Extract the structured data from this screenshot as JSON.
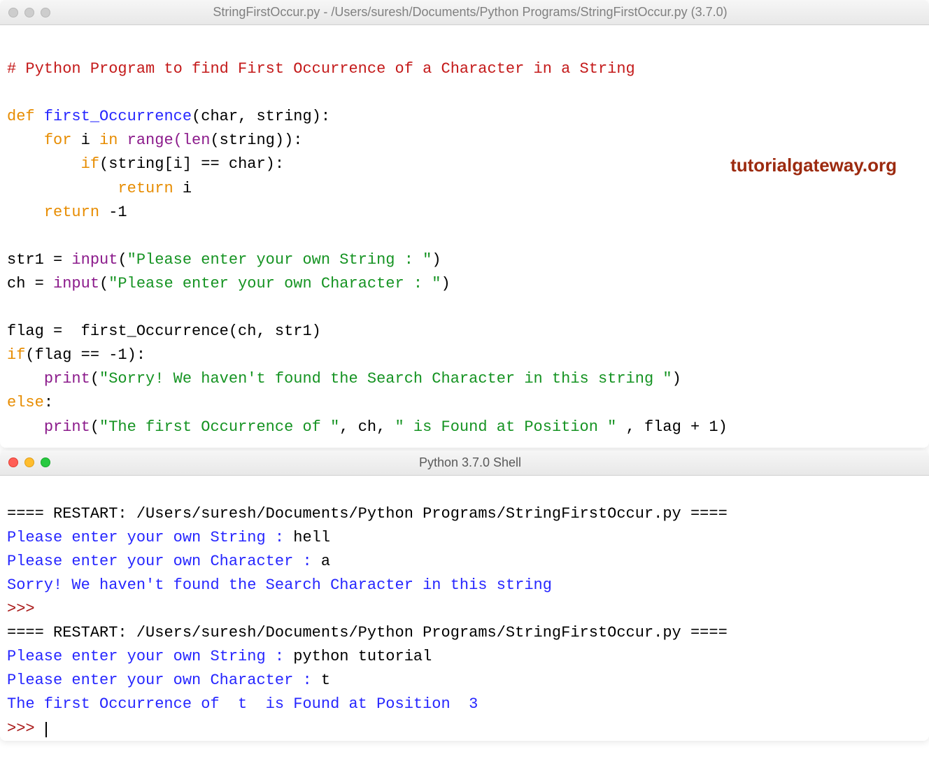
{
  "editor": {
    "title": "StringFirstOccur.py - /Users/suresh/Documents/Python Programs/StringFirstOccur.py (3.7.0)",
    "traffic_state": "inactive",
    "watermark": "tutorialgateway.org",
    "code": {
      "l1_comment": "# Python Program to find First Occurrence of a Character in a String",
      "l3_def": "def",
      "l3_func": " first_Occurrence",
      "l3_rest": "(char, string):",
      "l4_for": "for",
      "l4_i": " i ",
      "l4_in": "in",
      "l4_range": " range",
      "l4_len": "(len",
      "l4_end": "(string)):",
      "l5_if": "if",
      "l5_rest": "(string[i] == char):",
      "l6_return": "return",
      "l6_rest": " i",
      "l7_return": "return",
      "l7_rest": " -1",
      "l9_lhs": "str1 = ",
      "l9_input": "input",
      "l9_paren": "(",
      "l9_str": "\"Please enter your own String : \"",
      "l9_close": ")",
      "l10_lhs": "ch = ",
      "l10_input": "input",
      "l10_paren": "(",
      "l10_str": "\"Please enter your own Character : \"",
      "l10_close": ")",
      "l12": "flag =  first_Occurrence(ch, str1)",
      "l13_if": "if",
      "l13_rest": "(flag == -1):",
      "l14_print": "print",
      "l14_paren": "(",
      "l14_str": "\"Sorry! We haven't found the Search Character in this string \"",
      "l14_close": ")",
      "l15_else": "else",
      "l15_colon": ":",
      "l16_print": "print",
      "l16_paren": "(",
      "l16_str1": "\"The first Occurrence of \"",
      "l16_mid": ", ch, ",
      "l16_str2": "\" is Found at Position \"",
      "l16_end": " , flag + 1)"
    }
  },
  "shell": {
    "title": "Python 3.7.0 Shell",
    "traffic_state": "active",
    "lines": {
      "r1_pre": "==== ",
      "r1_restart": "RESTART: /Users/suresh/Documents/Python Programs/StringFirstOccur.py",
      "r1_post": " ====",
      "p1a": "Please enter your own String : ",
      "p1a_in": "hell",
      "p1b": "Please enter your own Character : ",
      "p1b_in": "a",
      "out1": "Sorry! We haven't found the Search Character in this string ",
      "prompt": ">>> ",
      "r2_pre": "==== ",
      "r2_restart": "RESTART: /Users/suresh/Documents/Python Programs/StringFirstOccur.py",
      "r2_post": " ====",
      "p2a": "Please enter your own String : ",
      "p2a_in": "python tutorial",
      "p2b": "Please enter your own Character : ",
      "p2b_in": "t",
      "out2": "The first Occurrence of  t  is Found at Position  3",
      "prompt2": ">>> "
    }
  }
}
